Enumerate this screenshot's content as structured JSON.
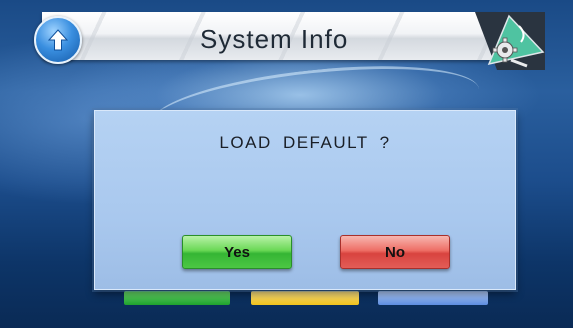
{
  "header": {
    "title": "System Info",
    "back_icon": "up-arrow-circle-icon",
    "settings_icon": "gear-wrench-icon"
  },
  "dialog": {
    "message": "LOAD  DEFAULT ?",
    "yes_label": "Yes",
    "no_label": "No"
  },
  "colors": {
    "yes_button": "#4cc744",
    "no_button": "#e35d57",
    "dialog_bg": "#aac9ee"
  }
}
